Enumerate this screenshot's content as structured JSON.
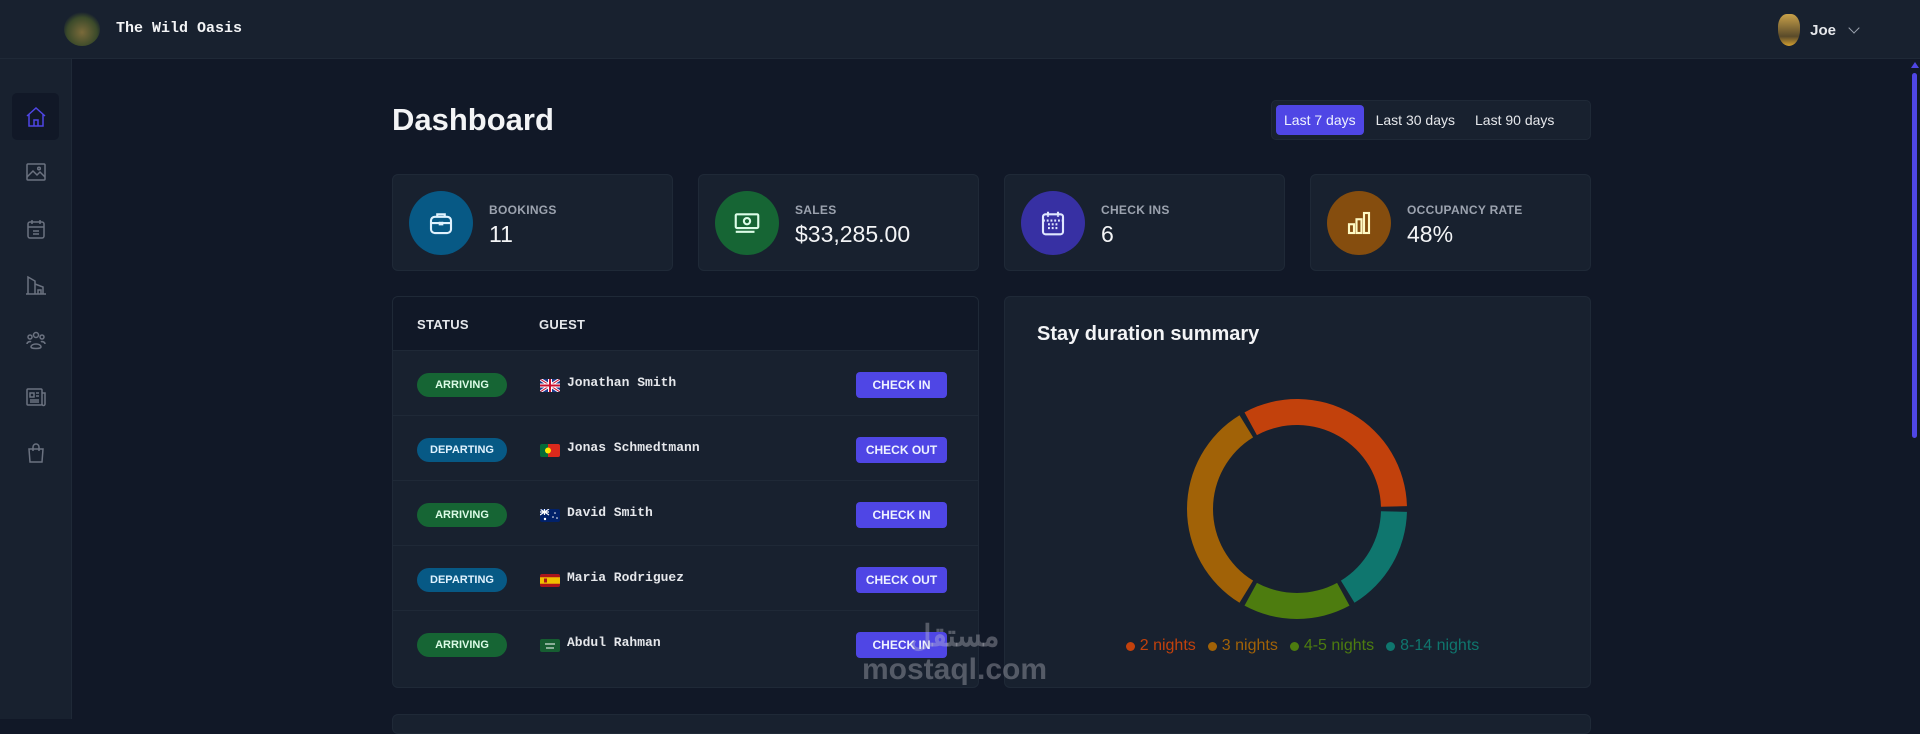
{
  "header": {
    "app_title": "The Wild Oasis",
    "user_name": "Joe",
    "logo_icon": "wild-oasis-logo",
    "avatar_icon": "user-avatar",
    "chevron_icon": "chevron-down-icon"
  },
  "sidebar": {
    "items": [
      {
        "name": "home",
        "icon": "home-icon",
        "active": true
      },
      {
        "name": "cabins",
        "icon": "image-icon"
      },
      {
        "name": "bookings",
        "icon": "calendar-icon"
      },
      {
        "name": "facilities",
        "icon": "building-icon"
      },
      {
        "name": "users",
        "icon": "users-icon"
      },
      {
        "name": "reports",
        "icon": "newspaper-icon"
      },
      {
        "name": "shop",
        "icon": "shopping-bag-icon"
      }
    ]
  },
  "main": {
    "title": "Dashboard",
    "filters": [
      {
        "label": "Last 7 days",
        "active": true
      },
      {
        "label": "Last 30 days"
      },
      {
        "label": "Last 90 days"
      }
    ],
    "stats": [
      {
        "label": "BOOKINGS",
        "value": "11",
        "icon": "briefcase-icon",
        "color": "#075985"
      },
      {
        "label": "SALES",
        "value": "$33,285.00",
        "icon": "banknotes-icon",
        "color": "#166534"
      },
      {
        "label": "CHECK INS",
        "value": "6",
        "icon": "calendar-days-icon",
        "color": "#3730a3"
      },
      {
        "label": "OCCUPANCY RATE",
        "value": "48%",
        "icon": "chart-bar-icon",
        "color": "#854d0e"
      }
    ],
    "activity": {
      "headers": {
        "status": "STATUS",
        "guest": "GUEST"
      },
      "rows": [
        {
          "status": "ARRIVING",
          "guest": "Jonathan Smith",
          "flag": "uk",
          "action": "CHECK IN"
        },
        {
          "status": "DEPARTING",
          "guest": "Jonas Schmedtmann",
          "flag": "pt",
          "action": "CHECK OUT"
        },
        {
          "status": "ARRIVING",
          "guest": "David Smith",
          "flag": "au",
          "action": "CHECK IN"
        },
        {
          "status": "DEPARTING",
          "guest": "Maria Rodriguez",
          "flag": "es",
          "action": "CHECK OUT"
        },
        {
          "status": "ARRIVING",
          "guest": "Abdul Rahman",
          "flag": "sa",
          "action": "CHECK IN"
        }
      ]
    }
  },
  "colors": {
    "accent": "#4f46e5",
    "arriving_bg": "#166534",
    "arriving_text": "#dcfce7",
    "departing_bg": "#075985",
    "departing_text": "#e0f2fe"
  },
  "chart_data": {
    "type": "pie",
    "title": "Stay duration summary",
    "donut": true,
    "legend": "bottom",
    "categories": [
      "2 nights",
      "3 nights",
      "4-5 nights",
      "8-14 nights"
    ],
    "values": [
      4,
      4,
      2,
      2
    ],
    "colors": [
      "#c2410c",
      "#a16207",
      "#4d7c0f",
      "#0f766e"
    ]
  },
  "watermark": {
    "text_ar": "مستقل",
    "text": "mostaql.com"
  }
}
